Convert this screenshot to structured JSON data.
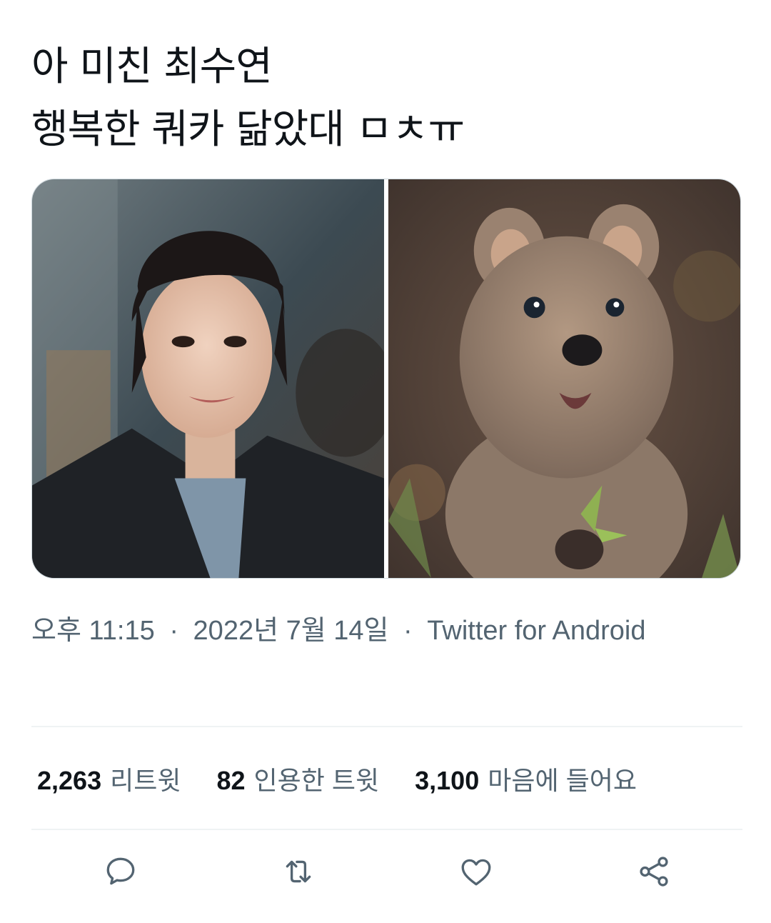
{
  "tweet": {
    "lines": [
      "아 미친 최수연",
      "행복한 쿼카 닮았대 ㅁㅊㅠ"
    ]
  },
  "media": [
    {
      "description_icon": "photo-woman"
    },
    {
      "description_icon": "photo-quokka"
    }
  ],
  "meta": {
    "time": "오후 11:15",
    "date": "2022년 7월 14일",
    "source": "Twitter for Android",
    "separator": "·"
  },
  "stats": [
    {
      "count": "2,263",
      "label": "리트윗"
    },
    {
      "count": "82",
      "label": "인용한 트윗"
    },
    {
      "count": "3,100",
      "label": "마음에 들어요"
    }
  ],
  "actions": [
    {
      "icon": "reply-icon"
    },
    {
      "icon": "retweet-icon"
    },
    {
      "icon": "like-icon"
    },
    {
      "icon": "share-icon"
    }
  ],
  "colors": {
    "text": "#0f1419",
    "secondary": "#536471",
    "divider": "#eff3f4",
    "border": "#cfd9de"
  }
}
